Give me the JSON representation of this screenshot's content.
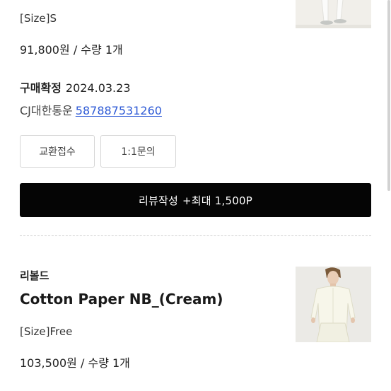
{
  "order1": {
    "size": "[Size]S",
    "price": "91,800원",
    "quantity_sep": "/",
    "quantity": "수량 1개",
    "status": "구매확정",
    "date": "2024.03.23",
    "courier": "CJ대한통운",
    "tracking_number": "587887531260",
    "buttons": {
      "exchange": "교환접수",
      "inquiry": "1:1문의"
    },
    "review": {
      "label": "리뷰작성",
      "bonus": "+최대 1,500P"
    }
  },
  "order2": {
    "brand": "리볼드",
    "product_name": "Cotton Paper NB_(Cream)",
    "size": "[Size]Free",
    "price": "103,500원",
    "quantity_sep": "/",
    "quantity": "수량 1개"
  },
  "colors": {
    "accent_link": "#2f5bd6",
    "primary_button": "#050505"
  }
}
